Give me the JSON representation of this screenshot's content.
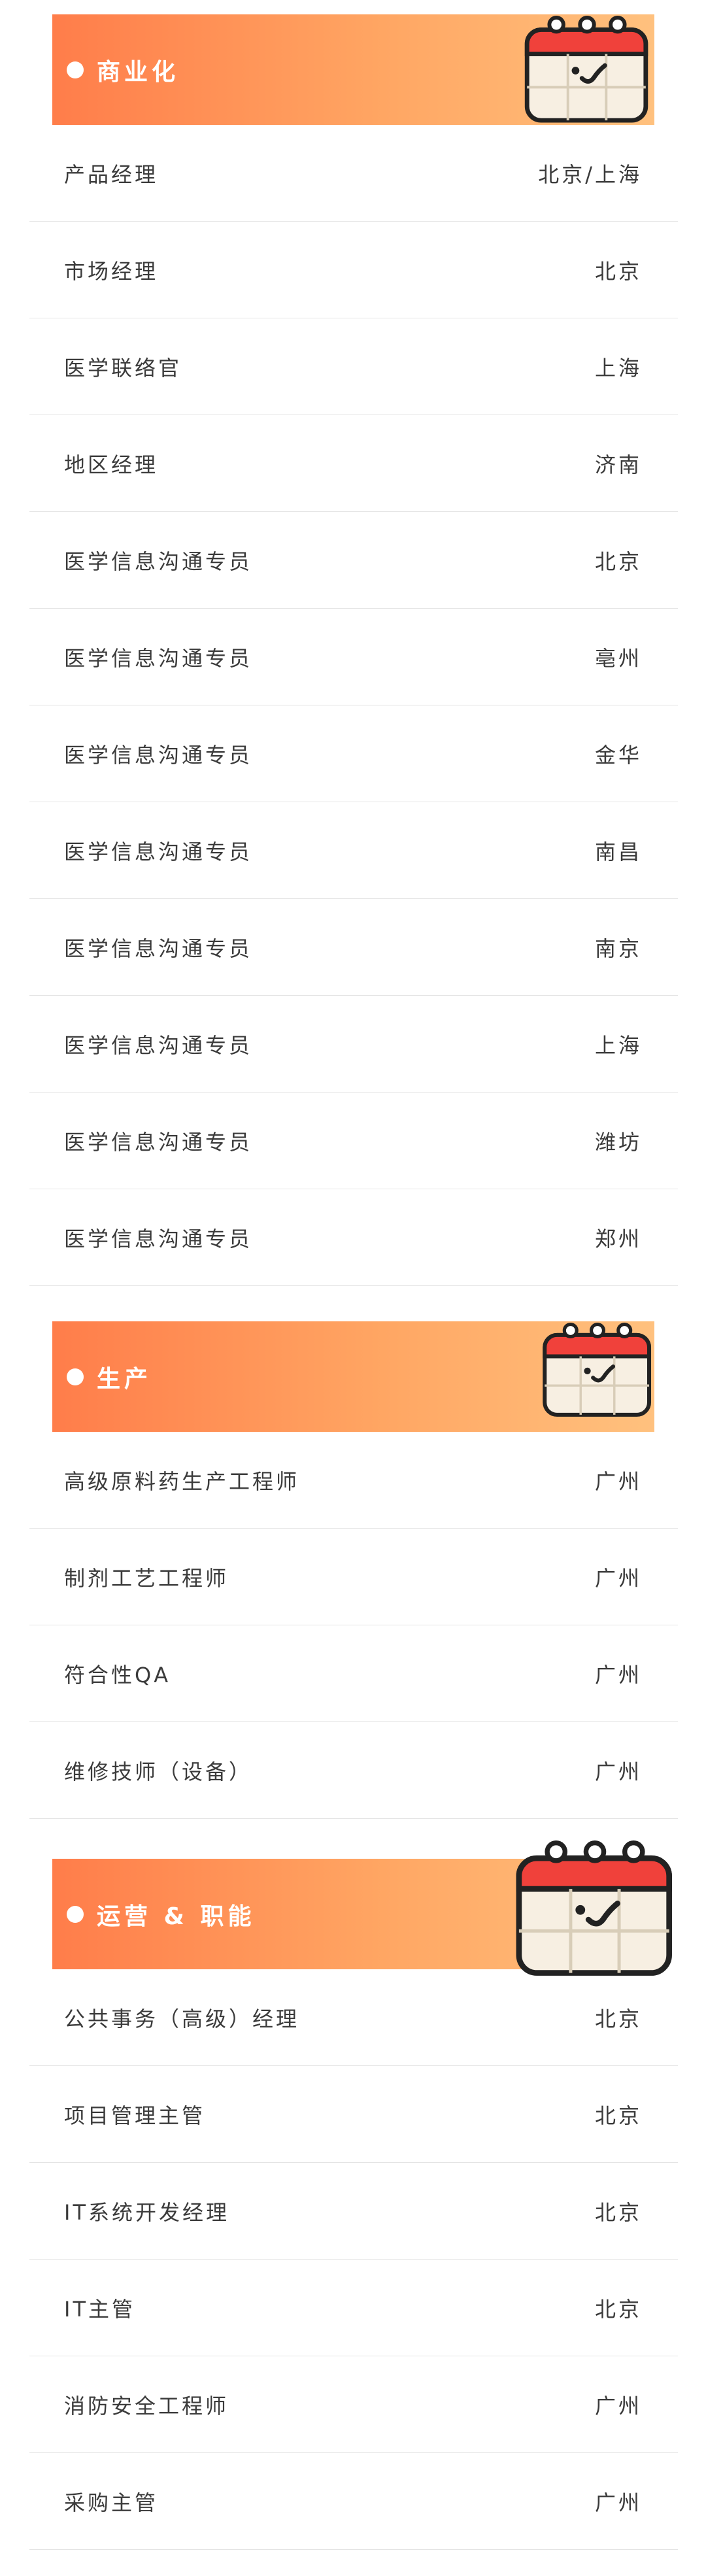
{
  "sections": [
    {
      "title": "商业化",
      "jobs": [
        {
          "title": "产品经理",
          "city": "北京/上海"
        },
        {
          "title": "市场经理",
          "city": "北京"
        },
        {
          "title": "医学联络官",
          "city": "上海"
        },
        {
          "title": "地区经理",
          "city": "济南"
        },
        {
          "title": "医学信息沟通专员",
          "city": "北京"
        },
        {
          "title": "医学信息沟通专员",
          "city": "亳州"
        },
        {
          "title": "医学信息沟通专员",
          "city": "金华"
        },
        {
          "title": "医学信息沟通专员",
          "city": "南昌"
        },
        {
          "title": "医学信息沟通专员",
          "city": "南京"
        },
        {
          "title": "医学信息沟通专员",
          "city": "上海"
        },
        {
          "title": "医学信息沟通专员",
          "city": "潍坊"
        },
        {
          "title": "医学信息沟通专员",
          "city": "郑州"
        }
      ]
    },
    {
      "title": "生产",
      "jobs": [
        {
          "title": "高级原料药生产工程师",
          "city": "广州"
        },
        {
          "title": "制剂工艺工程师",
          "city": "广州"
        },
        {
          "title": "符合性QA",
          "city": "广州"
        },
        {
          "title": "维修技师（设备）",
          "city": "广州"
        }
      ]
    },
    {
      "title": "运营 & 职能",
      "jobs": [
        {
          "title": "公共事务（高级）经理",
          "city": "北京"
        },
        {
          "title": "项目管理主管",
          "city": "北京"
        },
        {
          "title": "IT系统开发经理",
          "city": "北京"
        },
        {
          "title": "IT主管",
          "city": "北京"
        },
        {
          "title": "消防安全工程师",
          "city": "广州"
        },
        {
          "title": "采购主管",
          "city": "广州"
        }
      ]
    }
  ],
  "icons": {
    "banner_dot": "bullet-dot-icon",
    "calendar": "smiling-calendar-icon"
  },
  "colors": {
    "banner_start": "#ff7d4a",
    "banner_end": "#ffc17e",
    "calendar_header": "#f0413b"
  }
}
